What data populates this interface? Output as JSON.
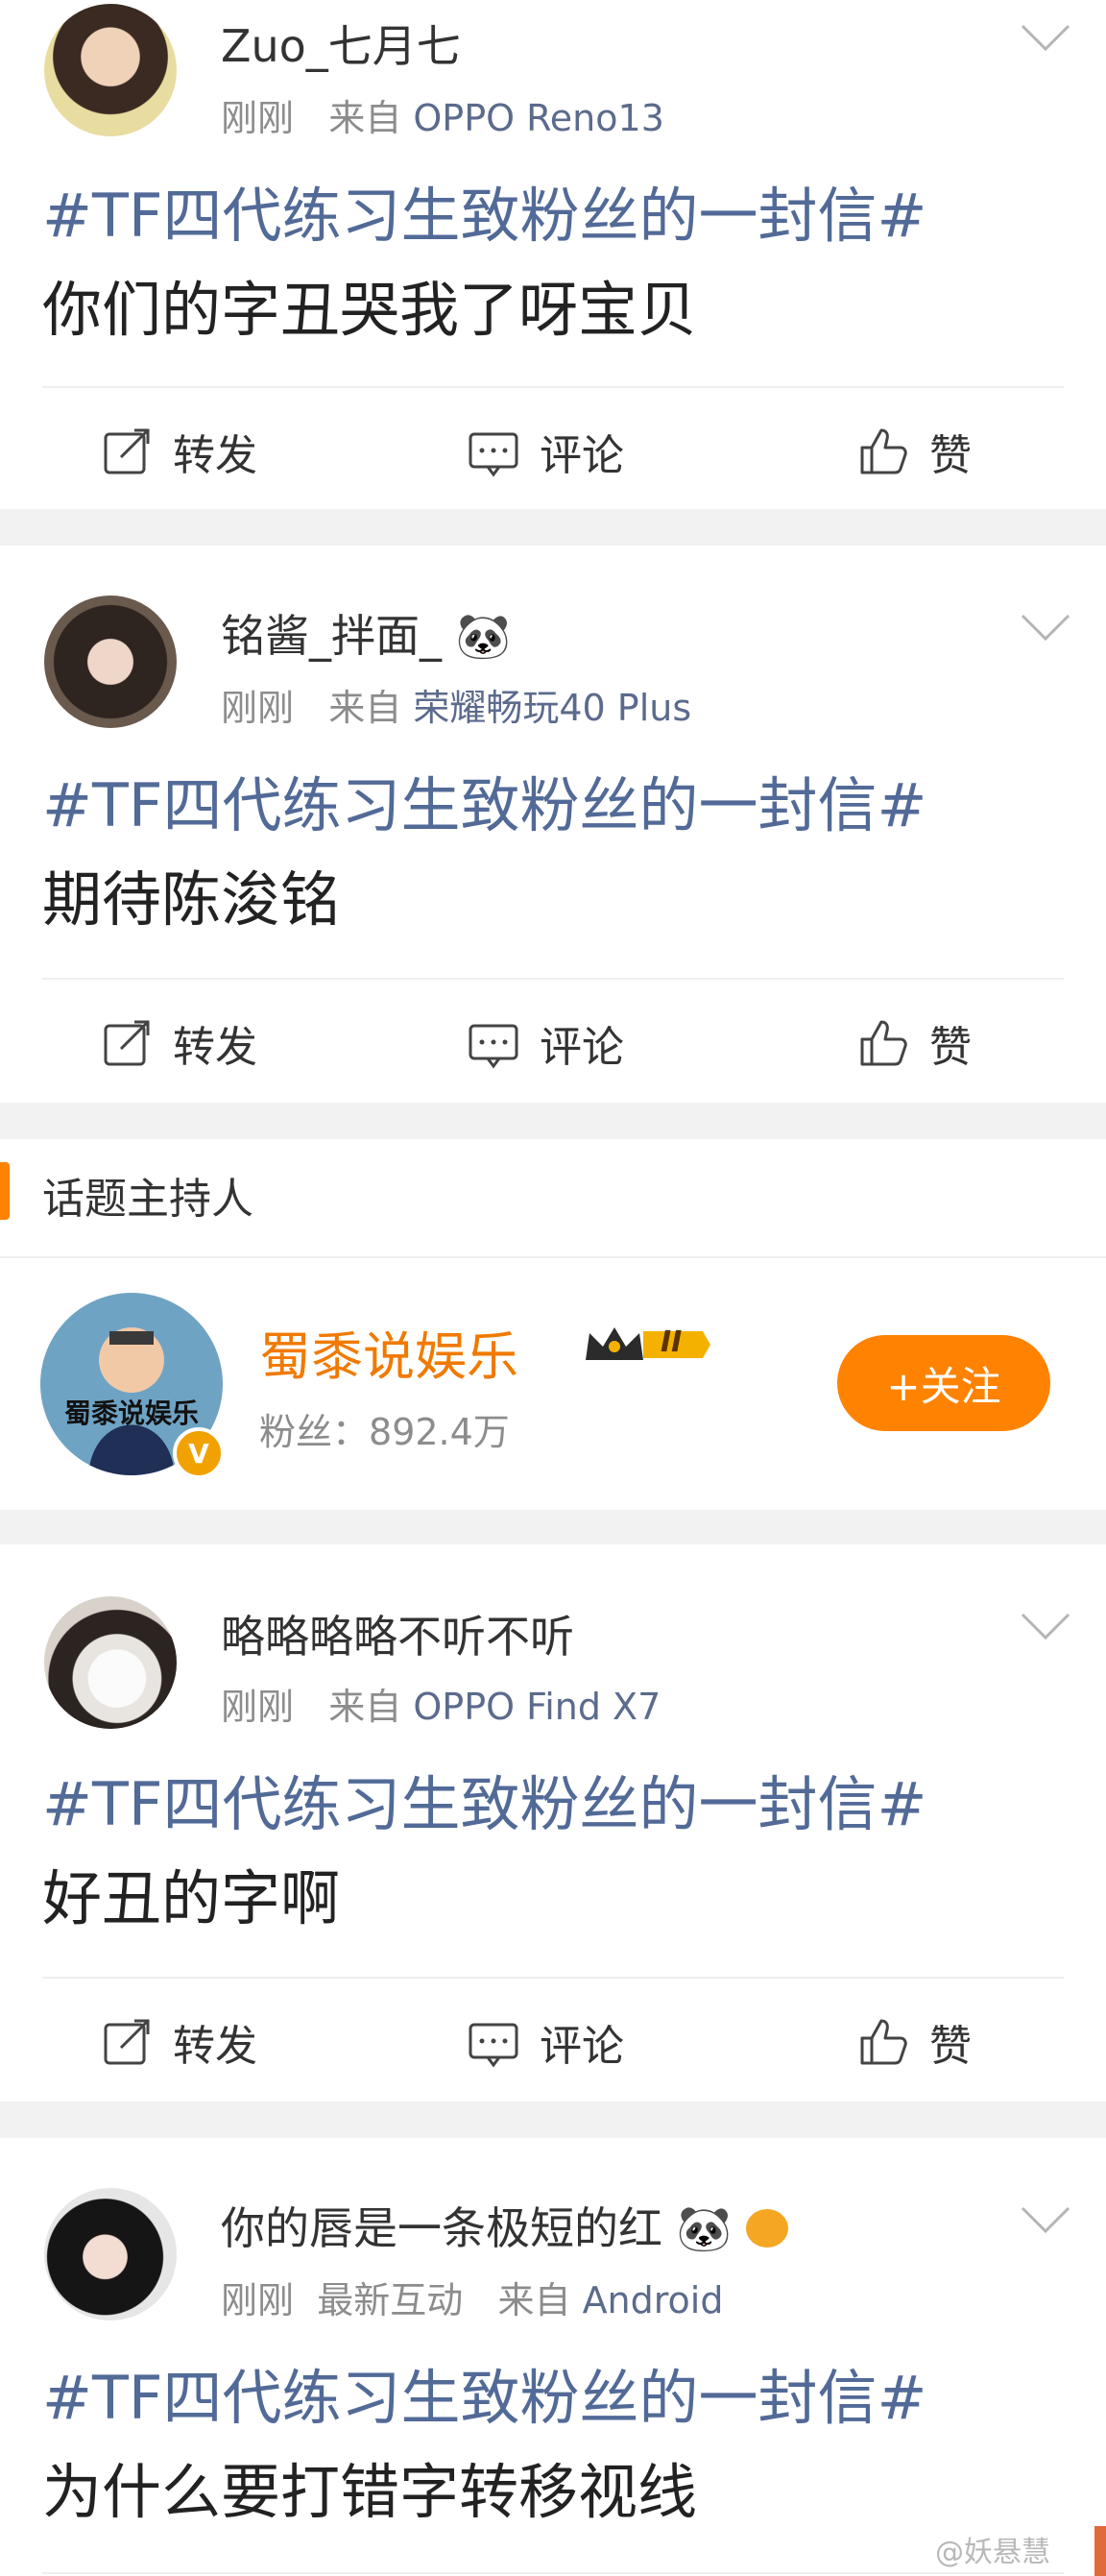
{
  "posts": [
    {
      "username": "Zuo_七月七",
      "time": "刚刚",
      "via_prefix": "来自",
      "source": "OPPO Reno13",
      "topic": "#TF四代练习生致粉丝的一封信#",
      "text": "你们的字丑哭我了呀宝贝",
      "actions": {
        "repost": "转发",
        "comment": "评论",
        "like": "赞"
      }
    },
    {
      "username": "铭酱_拌面_",
      "emoji": "🐼",
      "time": "刚刚",
      "via_prefix": "来自",
      "source": "荣耀畅玩40 Plus",
      "topic": "#TF四代练习生致粉丝的一封信#",
      "text": "期待陈浚铭",
      "actions": {
        "repost": "转发",
        "comment": "评论",
        "like": "赞"
      }
    },
    {
      "username": "略略略略不听不听",
      "time": "刚刚",
      "via_prefix": "来自",
      "source": "OPPO Find X7",
      "topic": "#TF四代练习生致粉丝的一封信#",
      "text": "好丑的字啊",
      "actions": {
        "repost": "转发",
        "comment": "评论",
        "like": "赞"
      }
    },
    {
      "username": "你的唇是一条极短的红",
      "emoji": "🐼",
      "time": "刚刚",
      "extra": "最新互动",
      "via_prefix": "来自",
      "source": "Android",
      "topic": "#TF四代练习生致粉丝的一封信#",
      "text": "为什么要打错字转移视线"
    }
  ],
  "host_section": {
    "title": "话题主持人",
    "name": "蜀黍说娱乐",
    "avatar_text": "蜀黍说娱乐",
    "level_badge": "II",
    "fans_label": "粉丝：",
    "fans_count": "892.4万",
    "follow_label": "+关注"
  },
  "watermark": "@妖悬慧",
  "colors": {
    "topic": "#526a97",
    "accent": "#ff8200",
    "meta": "#8c8c8c"
  }
}
